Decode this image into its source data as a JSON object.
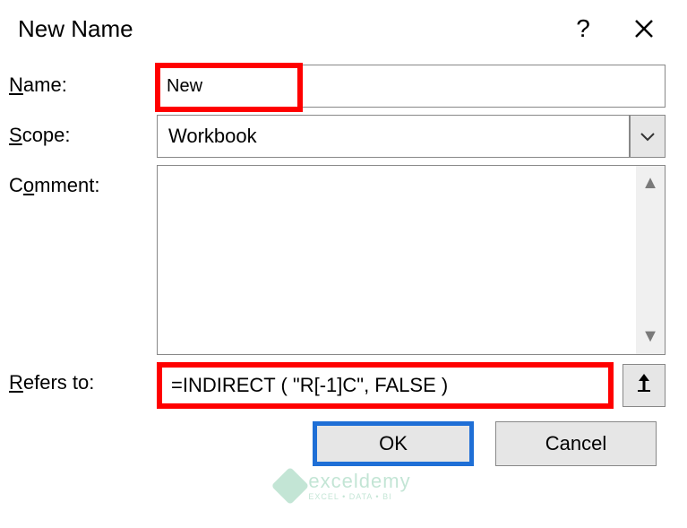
{
  "dialog": {
    "title": "New Name",
    "help_tooltip": "?",
    "close_tooltip": "×"
  },
  "fields": {
    "name_label_pre": "N",
    "name_label_post": "ame:",
    "name_value": "New",
    "scope_label_pre": "S",
    "scope_label_post": "cope:",
    "scope_value": "Workbook",
    "comment_label_pre": "C",
    "comment_label_mid": "o",
    "comment_label_post": "mment:",
    "comment_value": "",
    "refers_label_pre": "R",
    "refers_label_post": "efers to:",
    "refers_value": "=INDIRECT ( \"R[-1]C\", FALSE )"
  },
  "buttons": {
    "ok": "OK",
    "cancel": "Cancel"
  },
  "watermark": {
    "brand": "exceldemy",
    "tagline": "EXCEL • DATA • BI"
  }
}
